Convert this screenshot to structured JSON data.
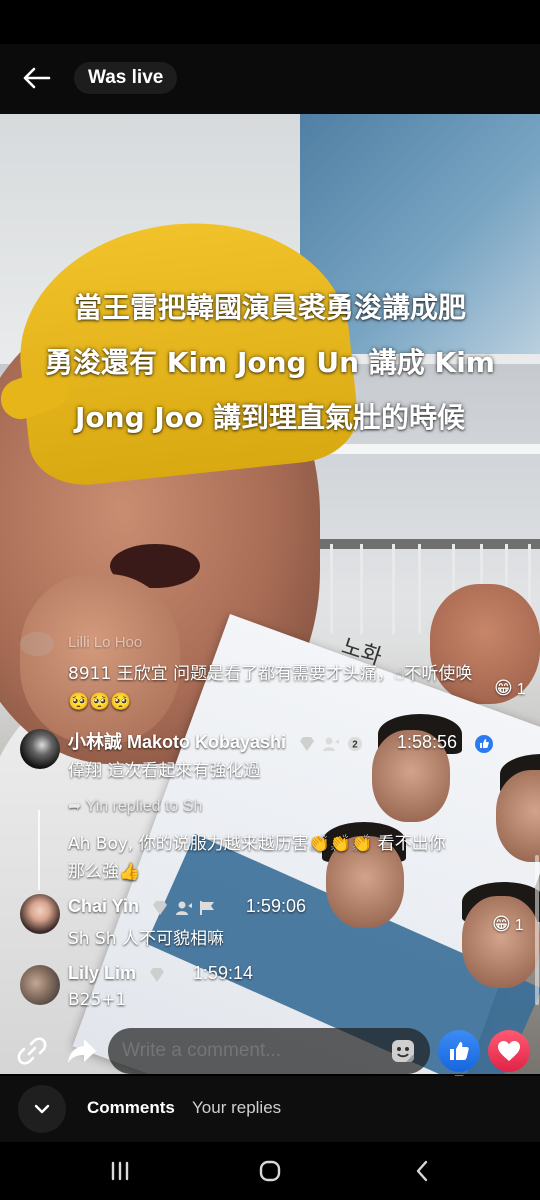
{
  "header": {
    "live_label": "Was live"
  },
  "video": {
    "caption_lines": [
      "當王雷把韓國演員裘勇浚講成肥",
      "勇浚還有 Kim Jong Un 講成 Kim",
      "Jong Joo 講到理直氣壯的時候"
    ],
    "card_label": "노화"
  },
  "comments": [
    {
      "name": "Lilli Lo Hoo",
      "text": "8911 王欣宜 问题是看了都有需要才头痛，☝不听使唤🥺🥺🥺",
      "reaction": "😁",
      "reaction_count": "1"
    },
    {
      "name": "小林誠 Makoto Kobayashi",
      "time": "1:58:56",
      "badge_number": "2",
      "text": "偉翔 這次看起來有強化過"
    },
    {
      "reply_marker": "Yin replied to Sh",
      "text": "Ah Boy, 你的说服力越来越历害👏👏👏 看不出你那么強👍"
    },
    {
      "name": "Chai Yin",
      "time": "1:59:06",
      "text": "Sh Sh 人不可貌相嘛",
      "reaction": "😁",
      "reaction_count": "1"
    },
    {
      "name": "Lily Lim",
      "time": "1:59:14",
      "text": "B25+1"
    }
  ],
  "composer": {
    "placeholder": "Write a comment..."
  },
  "bottom_tabs": {
    "comments": "Comments",
    "replies": "Your replies"
  },
  "colors": {
    "like": "#1766de",
    "heart": "#e02448",
    "cap": "#f1c22a"
  }
}
